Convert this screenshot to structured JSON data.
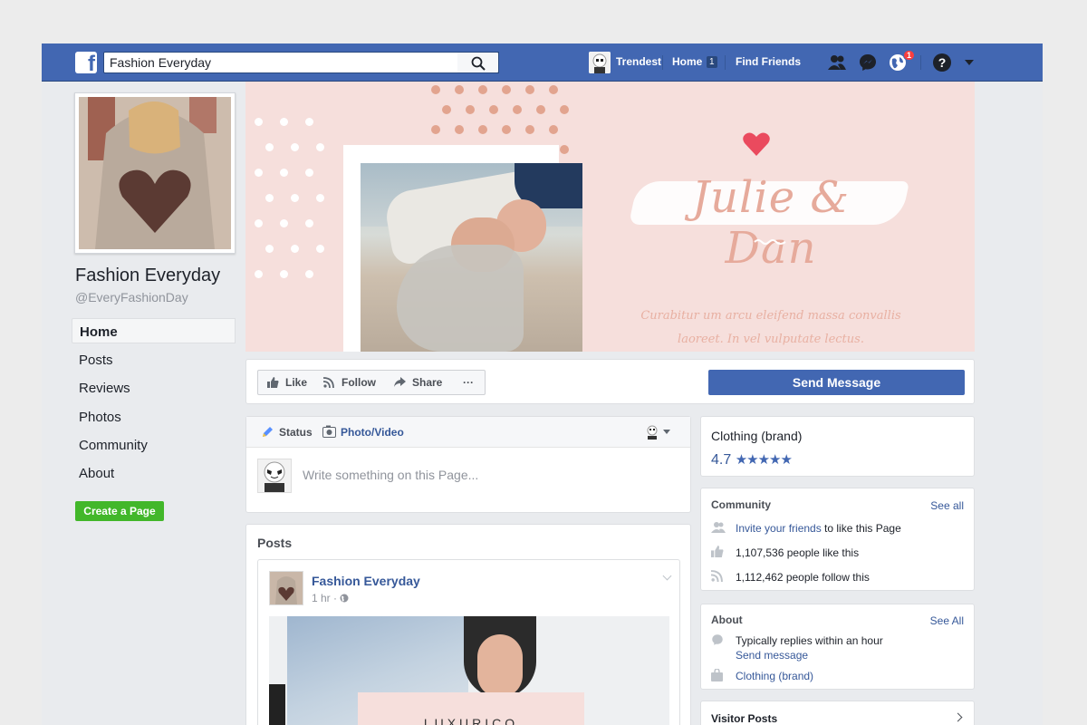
{
  "topbar": {
    "search_value": "Fashion Everyday",
    "profile_name": "Trendest",
    "home_label": "Home",
    "home_count": "1",
    "find_friends_label": "Find Friends",
    "notification_count": "1",
    "help_label": "?"
  },
  "page": {
    "name": "Fashion Everyday",
    "handle": "@EveryFashionDay"
  },
  "nav": {
    "items": [
      {
        "label": "Home"
      },
      {
        "label": "Posts"
      },
      {
        "label": "Reviews"
      },
      {
        "label": "Photos"
      },
      {
        "label": "Community"
      },
      {
        "label": "About"
      }
    ],
    "create_page_label": "Create a Page"
  },
  "cover": {
    "title": "Julie & Dan",
    "subtitle_line1": "Curabitur um arcu eleifend massa convallis",
    "subtitle_line2": "laoreet. In vel vulputate lectus."
  },
  "actions": {
    "like": "Like",
    "follow": "Follow",
    "share": "Share",
    "more": "···",
    "send_message": "Send Message"
  },
  "composer": {
    "status_tab": "Status",
    "photo_tab": "Photo/Video",
    "placeholder": "Write something on this Page..."
  },
  "posts": {
    "title": "Posts",
    "author": "Fashion Everyday",
    "time": "1 hr · ",
    "image_text": "LUXURICO"
  },
  "info": {
    "category": "Clothing (brand)",
    "rating": "4.7",
    "stars": "★★★★★"
  },
  "community": {
    "title": "Community",
    "see_all": "See all",
    "invite_link": "Invite your friends",
    "invite_rest": " to like this Page",
    "likes": "1,107,536 people like this",
    "follows": "1,112,462 people follow this"
  },
  "about": {
    "title": "About",
    "see_all": "See All",
    "reply_time": "Typically replies within an hour",
    "send_message": "Send message",
    "category": "Clothing (brand)"
  },
  "visitor_posts": {
    "title": "Visitor Posts"
  },
  "colors": {
    "brand_blue": "#4267b2",
    "link_blue": "#365899",
    "green": "#42b72a",
    "cover_pink": "#f6dfdc",
    "rose_gold": "#e6aa9b"
  }
}
